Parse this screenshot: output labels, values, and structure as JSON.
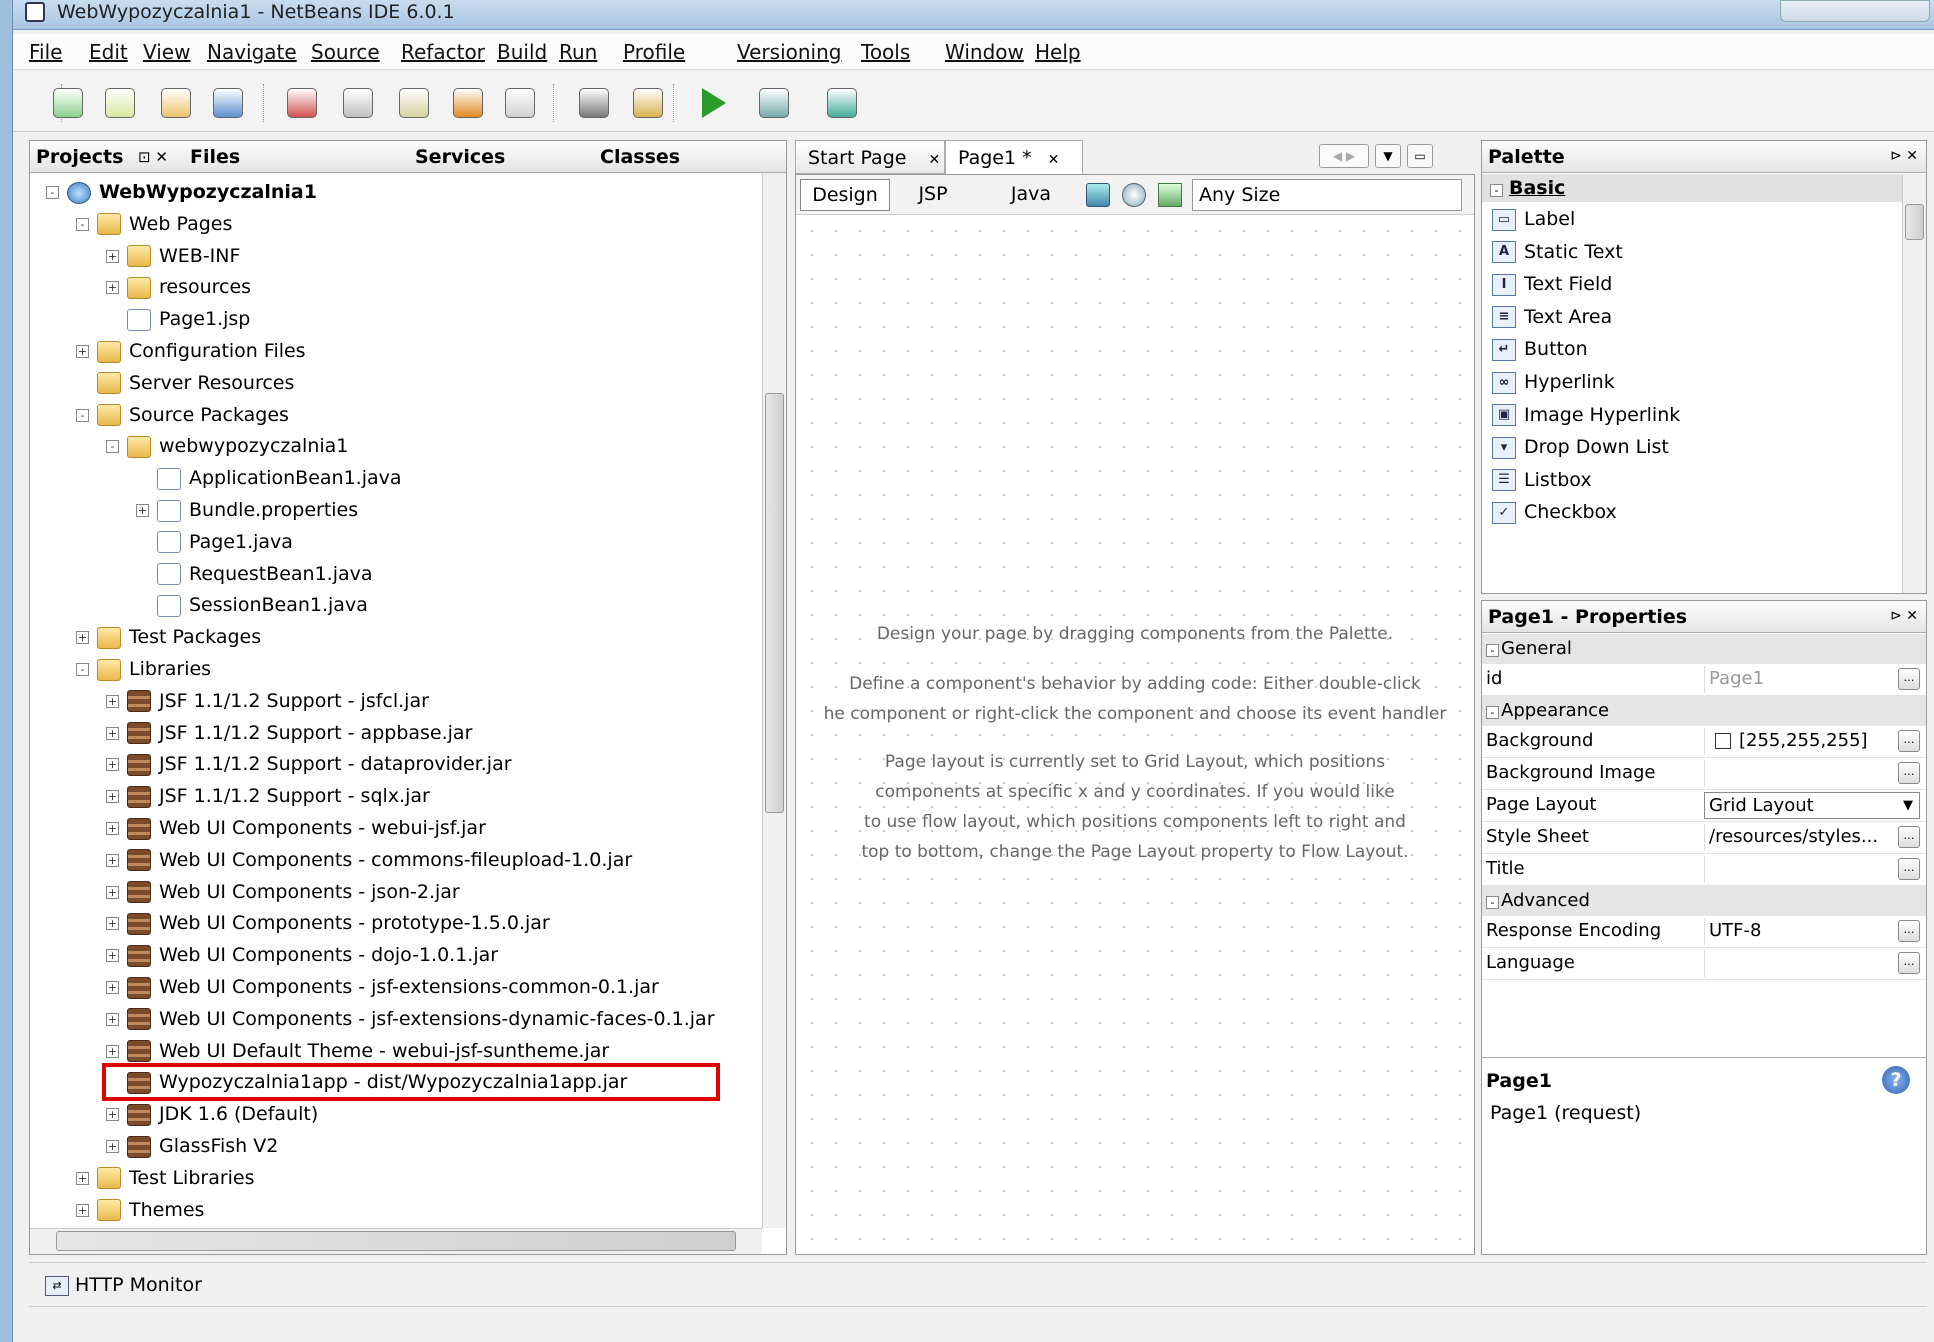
{
  "window": {
    "title": "WebWypozyczalnia1 - NetBeans IDE 6.0.1"
  },
  "menu": [
    "File",
    "Edit",
    "View",
    "Navigate",
    "Source",
    "Refactor",
    "Build",
    "Run",
    "Profile",
    "Versioning",
    "Tools",
    "Window",
    "Help"
  ],
  "toolbar": {
    "icons": [
      "new-project-icon",
      "new-file-icon",
      "open-project-icon",
      "save-all-icon",
      "cut-icon",
      "copy-icon",
      "paste-icon",
      "undo-icon",
      "redo-icon",
      "build-icon",
      "clean-build-icon",
      "run-icon",
      "debug-icon",
      "profile-icon"
    ]
  },
  "left_tabs": {
    "projects": "Projects",
    "files": "Files",
    "services": "Services",
    "classes": "Classes"
  },
  "tree": [
    {
      "label": "WebWypozyczalnia1",
      "depth": 0,
      "icon": "globe",
      "bold": true,
      "exp": "-"
    },
    {
      "label": "Web Pages",
      "depth": 1,
      "icon": "folder",
      "exp": "-"
    },
    {
      "label": "WEB-INF",
      "depth": 2,
      "icon": "folder",
      "exp": "+"
    },
    {
      "label": "resources",
      "depth": 2,
      "icon": "folder",
      "exp": "+"
    },
    {
      "label": "Page1.jsp",
      "depth": 2,
      "icon": "jfile",
      "exp": ""
    },
    {
      "label": "Configuration Files",
      "depth": 1,
      "icon": "folder",
      "exp": "+"
    },
    {
      "label": "Server Resources",
      "depth": 1,
      "icon": "folder",
      "exp": ""
    },
    {
      "label": "Source Packages",
      "depth": 1,
      "icon": "folder",
      "exp": "-"
    },
    {
      "label": "webwypozyczalnia1",
      "depth": 2,
      "icon": "folder",
      "exp": "-"
    },
    {
      "label": "ApplicationBean1.java",
      "depth": 3,
      "icon": "jfile",
      "exp": ""
    },
    {
      "label": "Bundle.properties",
      "depth": 3,
      "icon": "jfile",
      "exp": "+"
    },
    {
      "label": "Page1.java",
      "depth": 3,
      "icon": "jfile",
      "exp": ""
    },
    {
      "label": "RequestBean1.java",
      "depth": 3,
      "icon": "jfile",
      "exp": ""
    },
    {
      "label": "SessionBean1.java",
      "depth": 3,
      "icon": "jfile",
      "exp": ""
    },
    {
      "label": "Test Packages",
      "depth": 1,
      "icon": "folder",
      "exp": "+"
    },
    {
      "label": "Libraries",
      "depth": 1,
      "icon": "folder",
      "exp": "-"
    },
    {
      "label": "JSF 1.1/1.2 Support - jsfcl.jar",
      "depth": 2,
      "icon": "jar",
      "exp": "+"
    },
    {
      "label": "JSF 1.1/1.2 Support - appbase.jar",
      "depth": 2,
      "icon": "jar",
      "exp": "+"
    },
    {
      "label": "JSF 1.1/1.2 Support - dataprovider.jar",
      "depth": 2,
      "icon": "jar",
      "exp": "+"
    },
    {
      "label": "JSF 1.1/1.2 Support - sqlx.jar",
      "depth": 2,
      "icon": "jar",
      "exp": "+"
    },
    {
      "label": "Web UI Components - webui-jsf.jar",
      "depth": 2,
      "icon": "jar",
      "exp": "+"
    },
    {
      "label": "Web UI Components - commons-fileupload-1.0.jar",
      "depth": 2,
      "icon": "jar",
      "exp": "+"
    },
    {
      "label": "Web UI Components - json-2.jar",
      "depth": 2,
      "icon": "jar",
      "exp": "+"
    },
    {
      "label": "Web UI Components - prototype-1.5.0.jar",
      "depth": 2,
      "icon": "jar",
      "exp": "+"
    },
    {
      "label": "Web UI Components - dojo-1.0.1.jar",
      "depth": 2,
      "icon": "jar",
      "exp": "+"
    },
    {
      "label": "Web UI Components - jsf-extensions-common-0.1.jar",
      "depth": 2,
      "icon": "jar",
      "exp": "+"
    },
    {
      "label": "Web UI Components - jsf-extensions-dynamic-faces-0.1.jar",
      "depth": 2,
      "icon": "jar",
      "exp": "+"
    },
    {
      "label": "Web UI Default Theme - webui-jsf-suntheme.jar",
      "depth": 2,
      "icon": "jar",
      "exp": "+"
    },
    {
      "label": "Wypozyczalnia1app - dist/Wypozyczalnia1app.jar",
      "depth": 2,
      "icon": "jar",
      "exp": "",
      "highlight": true
    },
    {
      "label": "JDK 1.6 (Default)",
      "depth": 2,
      "icon": "jar",
      "exp": "+"
    },
    {
      "label": "GlassFish V2",
      "depth": 2,
      "icon": "jar",
      "exp": "+"
    },
    {
      "label": "Test Libraries",
      "depth": 1,
      "icon": "folder",
      "exp": "+"
    },
    {
      "label": "Themes",
      "depth": 1,
      "icon": "folder",
      "exp": "+"
    }
  ],
  "editor": {
    "tabs": [
      "Start Page",
      "Page1 *"
    ],
    "views": {
      "design": "Design",
      "jsp": "JSP",
      "java": "Java"
    },
    "size_select": "Any Size",
    "hints": [
      "Design your page by dragging components from the Palette.",
      "Define a component's behavior by adding code: Either double-click",
      "he component or right-click the component and choose its event handler",
      "Page layout is currently set to Grid Layout, which positions",
      "components at specific x and y coordinates.  If you would like",
      "to use flow layout, which positions components left to right and",
      "top to bottom, change the Page Layout property to Flow Layout."
    ]
  },
  "palette": {
    "title": "Palette",
    "category": "Basic",
    "items": [
      "Label",
      "Static Text",
      "Text Field",
      "Text Area",
      "Button",
      "Hyperlink",
      "Image Hyperlink",
      "Drop Down List",
      "Listbox",
      "Checkbox"
    ]
  },
  "properties": {
    "title": "Page1 - Properties",
    "sections": {
      "general": "General",
      "appearance": "Appearance",
      "advanced": "Advanced"
    },
    "rows": {
      "id": {
        "k": "id",
        "v": "Page1"
      },
      "background": {
        "k": "Background",
        "v": "[255,255,255]"
      },
      "background_image": {
        "k": "Background Image",
        "v": ""
      },
      "page_layout": {
        "k": "Page Layout",
        "v": "Grid Layout"
      },
      "style_sheet": {
        "k": "Style Sheet",
        "v": "/resources/styles..."
      },
      "title": {
        "k": "Title",
        "v": ""
      },
      "response_encoding": {
        "k": "Response Encoding",
        "v": "UTF-8"
      },
      "language": {
        "k": "Language",
        "v": ""
      }
    },
    "help_title": "Page1",
    "help_text": "Page1 (request)"
  },
  "bottom": {
    "http_monitor": "HTTP Monitor"
  },
  "colors": {
    "highlight_border": "#e00000",
    "title_bar": "#b5cfe9"
  }
}
